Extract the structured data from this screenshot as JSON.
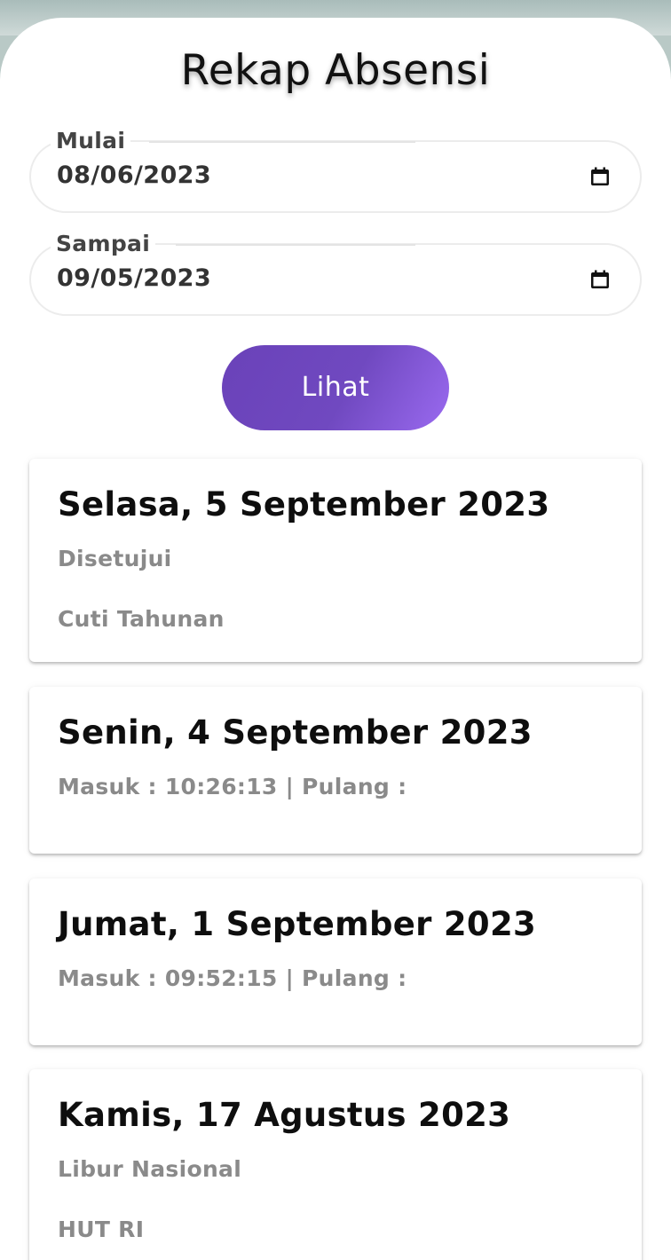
{
  "header": {
    "title": "Rekap Absensi"
  },
  "filters": {
    "start_label": "Mulai",
    "start_value": "08/06/2023",
    "end_label": "Sampai",
    "end_value": "09/05/2023",
    "view_button_label": "Lihat"
  },
  "records": [
    {
      "date": "Selasa, 5 September 2023",
      "status": "Disetujui",
      "note": "Cuti Tahunan"
    },
    {
      "date": "Senin, 4 September 2023",
      "status": "Masuk : 10:26:13 | Pulang :"
    },
    {
      "date": "Jumat, 1 September 2023",
      "status": "Masuk : 09:52:15 | Pulang :"
    },
    {
      "date": "Kamis, 17 Agustus 2023",
      "status": "Libur Nasional",
      "note": "HUT RI"
    }
  ],
  "colors": {
    "accent": "#6a42b9",
    "accent_end": "#9a6af0",
    "muted_text": "#8a8a8a"
  }
}
